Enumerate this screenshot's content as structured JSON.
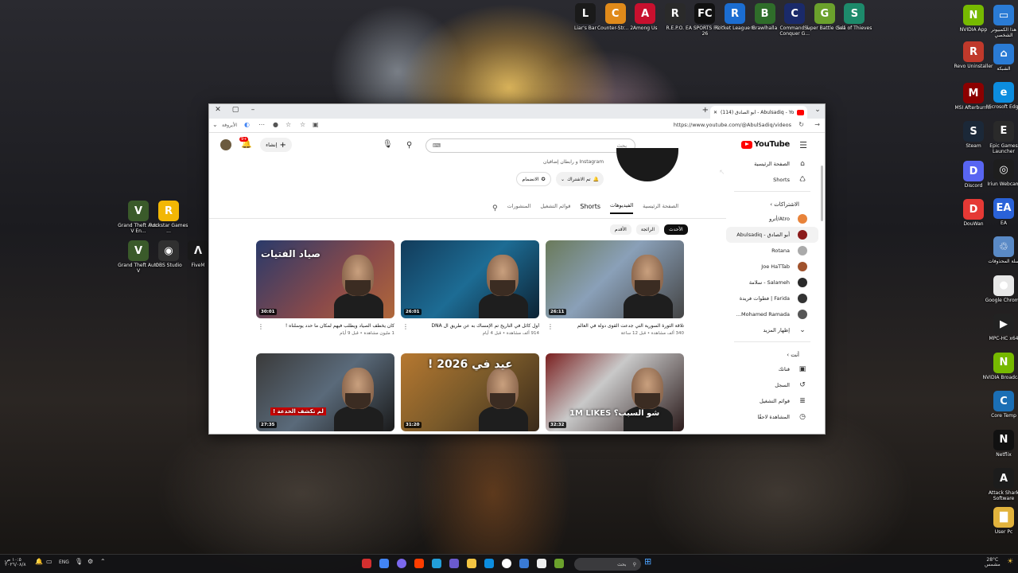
{
  "desktop": {
    "top_icons": [
      {
        "label": "Liar's Bar",
        "color": "#1a1a1a",
        "glyph": "L"
      },
      {
        "label": "Counter-Str... 2",
        "color": "#e08a1a",
        "glyph": "C"
      },
      {
        "label": "Among Us",
        "color": "#c8102e",
        "glyph": "A"
      },
      {
        "label": "R.E.P.O.",
        "color": "#2a2a2a",
        "glyph": "R"
      },
      {
        "label": "EA SPORTS FC™ 26",
        "color": "#111111",
        "glyph": "FC"
      },
      {
        "label": "Rocket League®",
        "color": "#1b6dd1",
        "glyph": "R"
      },
      {
        "label": "Brawlhalla",
        "color": "#2f6d2a",
        "glyph": "B"
      },
      {
        "label": "Command & Conquer G...",
        "color": "#1a2a6a",
        "glyph": "C"
      },
      {
        "label": "Super Battle Golf",
        "color": "#6ba12c",
        "glyph": "G"
      },
      {
        "label": "Sea of Thieves",
        "color": "#1d8a6b",
        "glyph": "S"
      }
    ],
    "left_icons": [
      {
        "label": "Grand Theft Auto V En...",
        "color": "#3a5a2a",
        "glyph": "V"
      },
      {
        "label": "Rockstar Games ...",
        "color": "#f2b705",
        "glyph": "R"
      },
      {
        "label": "Grand Theft Auto V",
        "color": "#3a5a2a",
        "glyph": "V"
      },
      {
        "label": "OBS Studio",
        "color": "#303030",
        "glyph": "◉"
      },
      {
        "label": "FiveM",
        "color": "#1a1a1a",
        "glyph": "Λ"
      }
    ],
    "right_col1": [
      {
        "label": "NVIDIA App",
        "color": "#76b900",
        "glyph": "N"
      },
      {
        "label": "Revo Uninstaller",
        "color": "#c0392b",
        "glyph": "R"
      },
      {
        "label": "MSI Afterburner",
        "color": "#8b0000",
        "glyph": "M"
      },
      {
        "label": "Steam",
        "color": "#1b2838",
        "glyph": "S"
      },
      {
        "label": "Discord",
        "color": "#5865f2",
        "glyph": "D"
      },
      {
        "label": "DouWan",
        "color": "#e53935",
        "glyph": "D"
      }
    ],
    "right_col2": [
      {
        "label": "هذا الكمبيوتر الشخصي",
        "color": "#2a7bd5",
        "glyph": "▭"
      },
      {
        "label": "الشبكة",
        "color": "#2a7bd5",
        "glyph": "⌂"
      },
      {
        "label": "Microsoft Edge",
        "color": "#0c8ddf",
        "glyph": "e"
      },
      {
        "label": "Epic Games Launcher",
        "color": "#2a2a2a",
        "glyph": "E"
      },
      {
        "label": "Iriun Webcam",
        "color": "#1e1e1e",
        "glyph": "◎"
      },
      {
        "label": "EA",
        "color": "#2a62d8",
        "glyph": "EA"
      },
      {
        "label": "سلة المحذوفات",
        "color": "#5a8ac6",
        "glyph": "♲"
      },
      {
        "label": "Google Chrome",
        "color": "#e8e8e8",
        "glyph": "●"
      },
      {
        "label": "MPC-HC x64",
        "color": "#222222",
        "glyph": "▶"
      },
      {
        "label": "NVIDIA Broadcast",
        "color": "#76b900",
        "glyph": "N"
      },
      {
        "label": "Core Temp",
        "color": "#1b6fb5",
        "glyph": "C"
      },
      {
        "label": "Netflix",
        "color": "#111111",
        "glyph": "N"
      },
      {
        "label": "Attack Shark Software",
        "color": "#1c1c1c",
        "glyph": "A"
      },
      {
        "label": "User Pc",
        "color": "#e2b33c",
        "glyph": "▇"
      }
    ]
  },
  "browser": {
    "tab_title": "(114) أبو الصادق - Abulsadiq - Yo",
    "url": "https://www.youtube.com/@AbulSadiq/videos",
    "bookmark_label": "الأيروفة",
    "new_tab": "+"
  },
  "youtube": {
    "logo_text": "YouTube",
    "logo_suffix": "AE",
    "search_placeholder": "بحث",
    "create_label": "إنشاء",
    "notif_count": "9+",
    "channel": {
      "links_text": "Instagram و رابطان إضافيان",
      "subscribe_label": "تم الاشتراك",
      "join_label": "الانضمام"
    },
    "tabs": [
      "الصفحة الرئيسية",
      "الفيديوهات",
      "Shorts",
      "قوائم التشغيل",
      "المنشورات"
    ],
    "chips": [
      "الأحدث",
      "الرائجة",
      "الأقدم"
    ],
    "sidebar": {
      "home": "الصفحة الرئيسية",
      "shorts": "Shorts",
      "subs_header": "الاشتراكات",
      "subs": [
        {
          "name": "Atro/أترو",
          "color": "#e8833a"
        },
        {
          "name": "أبو الصادق - Abulsadiq",
          "color": "#8b1a1a"
        },
        {
          "name": "Rotana",
          "color": "#aaaaaa"
        },
        {
          "name": "Joe HaTTab",
          "color": "#a0522d"
        },
        {
          "name": "Salameh - سلامة",
          "color": "#2a2a2a"
        },
        {
          "name": "Farida | فطوات فريدة",
          "color": "#333333"
        },
        {
          "name": "Mohamed Ramada...",
          "color": "#555555"
        }
      ],
      "show_more": "إظهار المزيد",
      "you_header": "أنت",
      "you_items": [
        "قناتك",
        "السجل",
        "قوائم التشغيل",
        "المشاهدة لاحقًا"
      ]
    },
    "videos": [
      {
        "title": "تلاقة الثورة السورية التي جدعت القوى دولة في العالم",
        "meta": "340 ألف مشاهدة • قبل 12 ساعة",
        "duration": "26:11",
        "overlay": ""
      },
      {
        "title": "أول كائل في التاريخ تم الإمساك به عن طريق ال DNA",
        "meta": "914 ألف مشاهدة • قبل 4 أيام",
        "duration": "26:01",
        "overlay": ""
      },
      {
        "title": "كان يخطف الصياد ويطلب فيهم لمكان ما حدد يوسلناه !",
        "meta": "1 مليون مشاهدة • قبل 9 أيام",
        "duration": "30:01",
        "overlay": "صياد الفتيات"
      },
      {
        "title": "",
        "meta": "",
        "duration": "32:32",
        "overlay": "شو السبب؟ 1M LIKES"
      },
      {
        "title": "",
        "meta": "",
        "duration": "31:20",
        "overlay": "عيد في 2026 !"
      },
      {
        "title": "",
        "meta": "",
        "duration": "27:35",
        "overlay": "لم تكشف الخدعة !"
      }
    ]
  },
  "taskbar": {
    "search_label": "بحث",
    "lang": "ENG",
    "time": "١٠:٥ ص",
    "date": "٢٠٢٦/٠٨/٨",
    "weather_temp": "28°C",
    "weather_desc": "مشمس"
  }
}
